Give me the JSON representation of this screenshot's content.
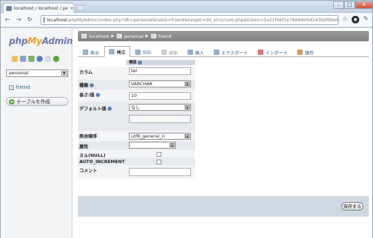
{
  "browser": {
    "tab_title": "localhost / localhost / pers",
    "tab_close": "×",
    "url_host": "localhost",
    "url_path": "/phpMyAdmin/index.php?db=personal&table=friend&target=tbl_structure.php&token=5a21f66f1e7669905d243bbf89e82cf9",
    "win_minimize": "–",
    "win_maximize": "□",
    "win_close": "✕"
  },
  "sidebar": {
    "logo_php": "php",
    "logo_my": "My",
    "logo_admin": "Admin",
    "db_selected": "personal",
    "tables": [
      "friend"
    ],
    "create_table": "テーブルを作成"
  },
  "breadcrumb": {
    "server": "localhost",
    "db": "personal",
    "table": "friend"
  },
  "tabs": [
    {
      "label": "表示",
      "state": "normal"
    },
    {
      "label": "構造",
      "state": "active"
    },
    {
      "label": "SQL",
      "state": "normal"
    },
    {
      "label": "検索",
      "state": "disabled"
    },
    {
      "label": "挿入",
      "state": "normal"
    },
    {
      "label": "エクスポート",
      "state": "normal"
    },
    {
      "label": "インポート",
      "state": "normal"
    },
    {
      "label": "操作",
      "state": "normal"
    }
  ],
  "form": {
    "header": "構造",
    "column_label": "カラム",
    "column_value": "tel",
    "type_label": "種類",
    "type_value": "VARCHAR",
    "length_label": "長さ/値",
    "length_value": "10",
    "default_label": "デフォルト値",
    "default_value": "なし",
    "collation_label": "照合順序",
    "collation_value": "utf8_general_ci",
    "attributes_label": "属性",
    "attributes_value": "",
    "null_label": "ヌル(NULL)",
    "ai_label": "AUTO_INCREMENT",
    "comment_label": "コメント",
    "comment_value": "",
    "save_label": "保存する"
  },
  "colors": {
    "logo_php": "#6c78a8",
    "logo_my": "#f29c22",
    "link": "#235a81",
    "breadcrumb_bg": "#8c8c8c",
    "footer_bg": "#d0d8e3"
  }
}
